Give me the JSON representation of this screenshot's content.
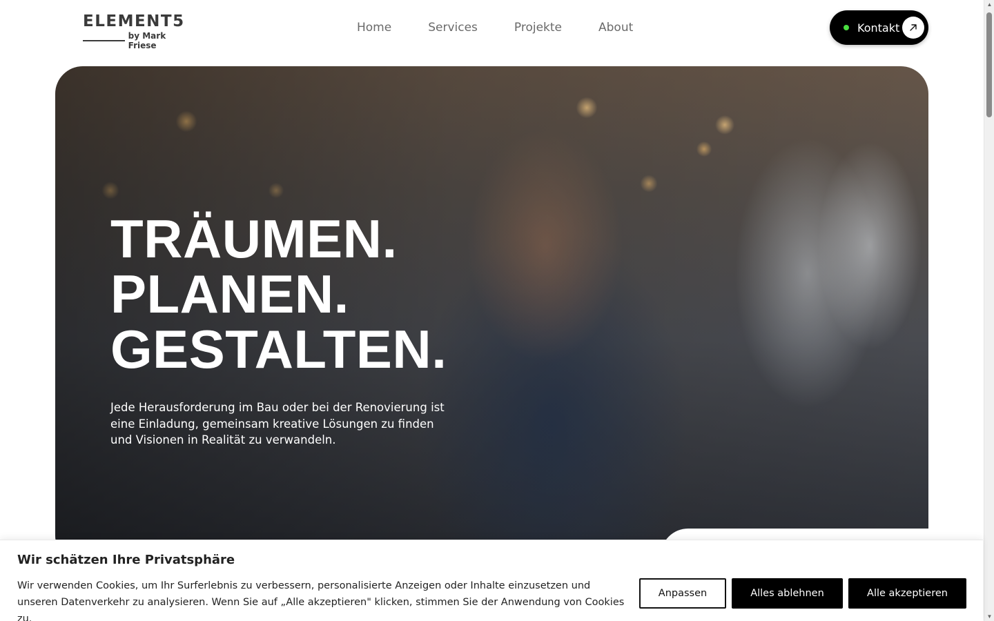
{
  "header": {
    "logo_main": "ELEMENT5",
    "logo_sub": "by Mark Friese",
    "nav": [
      {
        "label": "Home"
      },
      {
        "label": "Services"
      },
      {
        "label": "Projekte"
      },
      {
        "label": "About"
      }
    ],
    "contact_button": {
      "label": "Kontakt",
      "icon": "arrow-up-right-icon",
      "dot_color": "#4ade40"
    }
  },
  "hero": {
    "title_lines": [
      "TRÄUMEN.",
      "PLANEN.",
      "GESTALTEN."
    ],
    "text": "Jede Herausforderung im Bau oder bei der Renovierung ist eine Einladung, gemeinsam kreative Lösungen zu finden und Visionen in Realität zu verwandeln."
  },
  "cookie_banner": {
    "title": "Wir schätzen Ihre Privatsphäre",
    "text": "Wir verwenden Cookies, um Ihr Surferlebnis zu verbessern, personalisierte Anzeigen oder Inhalte einzusetzen und unseren Datenverkehr zu analysieren. Wenn Sie auf „Alle akzeptieren\" klicken, stimmen Sie der Anwendung von Cookies zu.",
    "buttons": {
      "customize": "Anpassen",
      "reject": "Alles ablehnen",
      "accept": "Alle akzeptieren"
    }
  }
}
